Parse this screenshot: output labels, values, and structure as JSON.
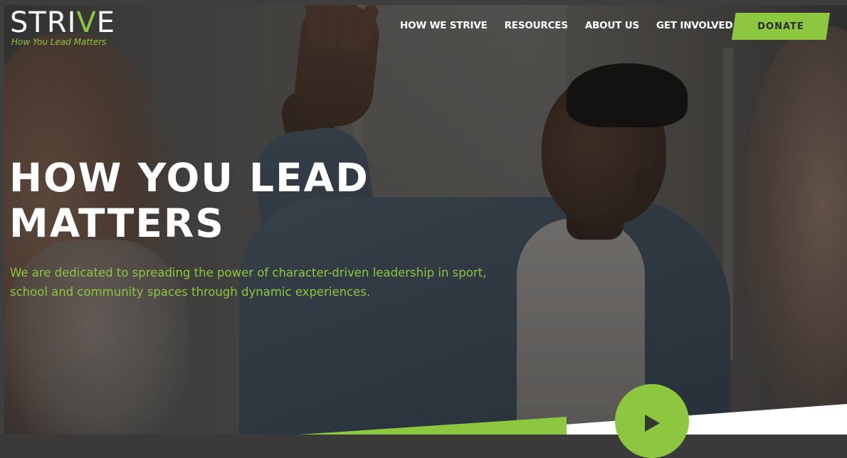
{
  "brand": {
    "name_part1": "STRI",
    "name_accent": "V",
    "name_part2": "E",
    "tagline": "How You Lead Matters"
  },
  "nav": {
    "items": [
      {
        "label": "HOW WE STRIVE"
      },
      {
        "label": "RESOURCES"
      },
      {
        "label": "ABOUT US"
      },
      {
        "label": "GET INVOLVED"
      }
    ],
    "donate_label": "DONATE"
  },
  "hero": {
    "headline_line1": "HOW YOU LEAD",
    "headline_line2": "MATTERS",
    "subcopy": "We are dedicated to spreading the power of character-driven leadership in sport, school and community spaces through dynamic experiences.",
    "play_icon": "play-icon"
  },
  "colors": {
    "accent": "#8dc63f",
    "text": "#ffffff",
    "button_text": "#2b2b2b"
  }
}
